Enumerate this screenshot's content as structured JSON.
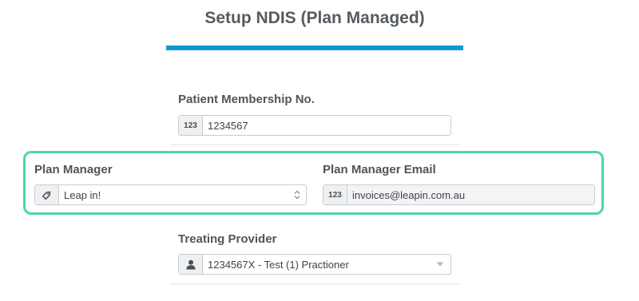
{
  "page": {
    "title": "Setup NDIS (Plan Managed)"
  },
  "colors": {
    "accent_bar": "#0f9ad3",
    "highlight_border": "#4dd6aa"
  },
  "membership": {
    "label": "Patient Membership No.",
    "addon": "123",
    "value": "1234567"
  },
  "plan_manager": {
    "label": "Plan Manager",
    "icon": "tag-icon",
    "value": "Leap in!"
  },
  "plan_manager_email": {
    "label": "Plan Manager Email",
    "addon": "123",
    "value": "invoices@leapin.com.au"
  },
  "treating_provider": {
    "label": "Treating Provider",
    "icon": "person-icon",
    "value": "1234567X - Test (1) Practioner"
  }
}
